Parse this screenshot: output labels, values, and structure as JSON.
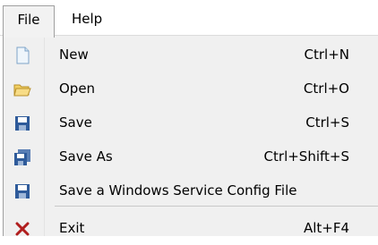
{
  "menubar": {
    "file": "File",
    "help": "Help"
  },
  "file_menu": {
    "items": [
      {
        "label": "New",
        "shortcut": "Ctrl+N",
        "icon": "new-file-icon"
      },
      {
        "label": "Open",
        "shortcut": "Ctrl+O",
        "icon": "open-folder-icon"
      },
      {
        "label": "Save",
        "shortcut": "Ctrl+S",
        "icon": "save-disk-icon"
      },
      {
        "label": "Save As",
        "shortcut": "Ctrl+Shift+S",
        "icon": "save-as-disk-icon"
      },
      {
        "label": "Save a Windows Service Config File",
        "shortcut": "",
        "icon": "save-disk-icon"
      },
      {
        "label": "Exit",
        "shortcut": "Alt+F4",
        "icon": "exit-x-icon"
      }
    ]
  },
  "colors": {
    "disk_blue": "#2f5b9a",
    "folder_yellow": "#e8c24a",
    "exit_red": "#b01e1e"
  }
}
